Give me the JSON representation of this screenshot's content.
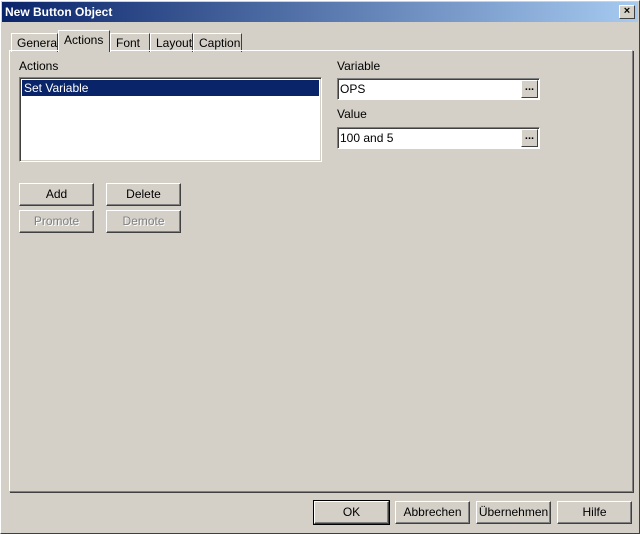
{
  "window": {
    "title": "New Button Object",
    "close_label": "×"
  },
  "tabs": [
    {
      "label": "General"
    },
    {
      "label": "Actions"
    },
    {
      "label": "Font"
    },
    {
      "label": "Layout"
    },
    {
      "label": "Caption"
    }
  ],
  "active_tab": "Actions",
  "actions": {
    "label": "Actions",
    "items": [
      {
        "label": "Set Variable"
      }
    ],
    "selected": "Set Variable",
    "buttons": {
      "add": "Add",
      "delete": "Delete",
      "promote": "Promote",
      "demote": "Demote"
    }
  },
  "variable": {
    "label": "Variable",
    "value": "OPS",
    "browse": "..."
  },
  "value": {
    "label": "Value",
    "value": "100 and 5",
    "browse": "..."
  },
  "footer": {
    "ok": "OK",
    "cancel": "Abbrechen",
    "apply": "Übernehmen",
    "help": "Hilfe"
  }
}
